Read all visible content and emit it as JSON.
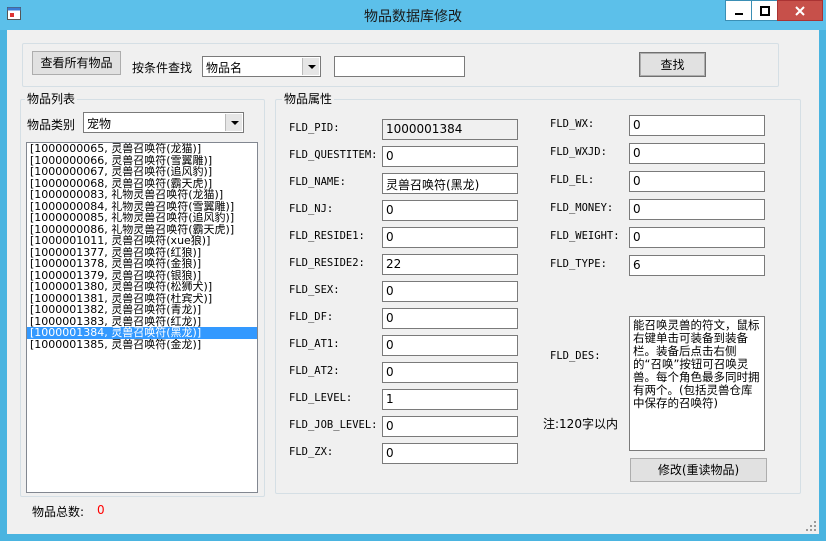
{
  "window": {
    "title": "物品数据库修改"
  },
  "toolbar": {
    "view_all_label": "查看所有物品",
    "search_by_label": "按条件查找",
    "search_field_value": "物品名",
    "search_text_value": "",
    "search_button_label": "查找"
  },
  "list_panel": {
    "title": "物品列表",
    "category_label": "物品类别",
    "category_value": "宠物",
    "items": [
      "[1000000065, 灵兽召唤符(龙猫)]",
      "[1000000066, 灵兽召唤符(雪翼雕)]",
      "[1000000067, 灵兽召唤符(追风豹)]",
      "[1000000068, 灵兽召唤符(霸天虎)]",
      "[1000000083, 礼物灵兽召唤符(龙猫)]",
      "[1000000084, 礼物灵兽召唤符(雪翼雕)]",
      "[1000000085, 礼物灵兽召唤符(追风豹)]",
      "[1000000086, 礼物灵兽召唤符(霸天虎)]",
      "[1000001011, 灵兽召唤符(xue狼)]",
      "[1000001377, 灵兽召唤符(红狼)]",
      "[1000001378, 灵兽召唤符(金狼)]",
      "[1000001379, 灵兽召唤符(银狼)]",
      "[1000001380, 灵兽召唤符(松狮犬)]",
      "[1000001381, 灵兽召唤符(杜宾犬)]",
      "[1000001382, 灵兽召唤符(青龙)]",
      "[1000001383, 灵兽召唤符(红龙)]",
      "[1000001384, 灵兽召唤符(黑龙)]",
      "[1000001385, 灵兽召唤符(金龙)]"
    ],
    "selected_index": 16,
    "total_label": "物品总数:",
    "total_value": "0"
  },
  "props_panel": {
    "title": "物品属性",
    "left_fields": [
      {
        "label": "FLD_PID:",
        "value": "1000001384",
        "readonly": true
      },
      {
        "label": "FLD_QUESTITEM:",
        "value": "0"
      },
      {
        "label": "FLD_NAME:",
        "value": "灵兽召唤符(黑龙)"
      },
      {
        "label": "FLD_NJ:",
        "value": "0"
      },
      {
        "label": "FLD_RESIDE1:",
        "value": "0"
      },
      {
        "label": "FLD_RESIDE2:",
        "value": "22"
      },
      {
        "label": "FLD_SEX:",
        "value": "0"
      },
      {
        "label": "FLD_DF:",
        "value": "0"
      },
      {
        "label": "FLD_AT1:",
        "value": "0"
      },
      {
        "label": "FLD_AT2:",
        "value": "0"
      },
      {
        "label": "FLD_LEVEL:",
        "value": "1"
      },
      {
        "label": "FLD_JOB_LEVEL:",
        "value": "0"
      },
      {
        "label": "FLD_ZX:",
        "value": "0"
      }
    ],
    "right_fields": [
      {
        "label": "FLD_WX:",
        "value": "0"
      },
      {
        "label": "FLD_WXJD:",
        "value": "0"
      },
      {
        "label": "FLD_EL:",
        "value": "0"
      },
      {
        "label": "FLD_MONEY:",
        "value": "0"
      },
      {
        "label": "FLD_WEIGHT:",
        "value": "0"
      },
      {
        "label": "FLD_TYPE:",
        "value": "6"
      }
    ],
    "des_label": "FLD_DES:",
    "des_value": "能召唤灵兽的符文，鼠标右键单击可装备到装备栏。装备后点击右侧的“召唤”按钮可召唤灵兽。每个角色最多同时拥有两个。(包括灵兽仓库中保存的召唤符)",
    "des_note": "注:120字以内",
    "modify_button_label": "修改(重读物品)"
  },
  "colors": {
    "titlebar": "#5cc0ea",
    "close_button": "#c7504a",
    "selection": "#3399ff",
    "total_value": "#ff0000"
  }
}
